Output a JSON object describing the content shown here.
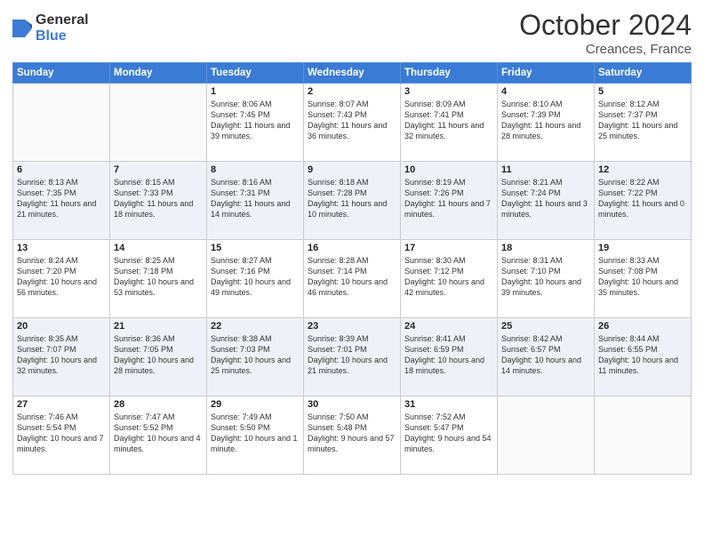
{
  "logo": {
    "general": "General",
    "blue": "Blue"
  },
  "header": {
    "month_year": "October 2024",
    "location": "Creances, France"
  },
  "days": [
    "Sunday",
    "Monday",
    "Tuesday",
    "Wednesday",
    "Thursday",
    "Friday",
    "Saturday"
  ],
  "weeks": [
    [
      {
        "num": "",
        "sunrise": "",
        "sunset": "",
        "daylight": ""
      },
      {
        "num": "",
        "sunrise": "",
        "sunset": "",
        "daylight": ""
      },
      {
        "num": "1",
        "sunrise": "Sunrise: 8:06 AM",
        "sunset": "Sunset: 7:45 PM",
        "daylight": "Daylight: 11 hours and 39 minutes."
      },
      {
        "num": "2",
        "sunrise": "Sunrise: 8:07 AM",
        "sunset": "Sunset: 7:43 PM",
        "daylight": "Daylight: 11 hours and 36 minutes."
      },
      {
        "num": "3",
        "sunrise": "Sunrise: 8:09 AM",
        "sunset": "Sunset: 7:41 PM",
        "daylight": "Daylight: 11 hours and 32 minutes."
      },
      {
        "num": "4",
        "sunrise": "Sunrise: 8:10 AM",
        "sunset": "Sunset: 7:39 PM",
        "daylight": "Daylight: 11 hours and 28 minutes."
      },
      {
        "num": "5",
        "sunrise": "Sunrise: 8:12 AM",
        "sunset": "Sunset: 7:37 PM",
        "daylight": "Daylight: 11 hours and 25 minutes."
      }
    ],
    [
      {
        "num": "6",
        "sunrise": "Sunrise: 8:13 AM",
        "sunset": "Sunset: 7:35 PM",
        "daylight": "Daylight: 11 hours and 21 minutes."
      },
      {
        "num": "7",
        "sunrise": "Sunrise: 8:15 AM",
        "sunset": "Sunset: 7:33 PM",
        "daylight": "Daylight: 11 hours and 18 minutes."
      },
      {
        "num": "8",
        "sunrise": "Sunrise: 8:16 AM",
        "sunset": "Sunset: 7:31 PM",
        "daylight": "Daylight: 11 hours and 14 minutes."
      },
      {
        "num": "9",
        "sunrise": "Sunrise: 8:18 AM",
        "sunset": "Sunset: 7:28 PM",
        "daylight": "Daylight: 11 hours and 10 minutes."
      },
      {
        "num": "10",
        "sunrise": "Sunrise: 8:19 AM",
        "sunset": "Sunset: 7:26 PM",
        "daylight": "Daylight: 11 hours and 7 minutes."
      },
      {
        "num": "11",
        "sunrise": "Sunrise: 8:21 AM",
        "sunset": "Sunset: 7:24 PM",
        "daylight": "Daylight: 11 hours and 3 minutes."
      },
      {
        "num": "12",
        "sunrise": "Sunrise: 8:22 AM",
        "sunset": "Sunset: 7:22 PM",
        "daylight": "Daylight: 11 hours and 0 minutes."
      }
    ],
    [
      {
        "num": "13",
        "sunrise": "Sunrise: 8:24 AM",
        "sunset": "Sunset: 7:20 PM",
        "daylight": "Daylight: 10 hours and 56 minutes."
      },
      {
        "num": "14",
        "sunrise": "Sunrise: 8:25 AM",
        "sunset": "Sunset: 7:18 PM",
        "daylight": "Daylight: 10 hours and 53 minutes."
      },
      {
        "num": "15",
        "sunrise": "Sunrise: 8:27 AM",
        "sunset": "Sunset: 7:16 PM",
        "daylight": "Daylight: 10 hours and 49 minutes."
      },
      {
        "num": "16",
        "sunrise": "Sunrise: 8:28 AM",
        "sunset": "Sunset: 7:14 PM",
        "daylight": "Daylight: 10 hours and 46 minutes."
      },
      {
        "num": "17",
        "sunrise": "Sunrise: 8:30 AM",
        "sunset": "Sunset: 7:12 PM",
        "daylight": "Daylight: 10 hours and 42 minutes."
      },
      {
        "num": "18",
        "sunrise": "Sunrise: 8:31 AM",
        "sunset": "Sunset: 7:10 PM",
        "daylight": "Daylight: 10 hours and 39 minutes."
      },
      {
        "num": "19",
        "sunrise": "Sunrise: 8:33 AM",
        "sunset": "Sunset: 7:08 PM",
        "daylight": "Daylight: 10 hours and 35 minutes."
      }
    ],
    [
      {
        "num": "20",
        "sunrise": "Sunrise: 8:35 AM",
        "sunset": "Sunset: 7:07 PM",
        "daylight": "Daylight: 10 hours and 32 minutes."
      },
      {
        "num": "21",
        "sunrise": "Sunrise: 8:36 AM",
        "sunset": "Sunset: 7:05 PM",
        "daylight": "Daylight: 10 hours and 28 minutes."
      },
      {
        "num": "22",
        "sunrise": "Sunrise: 8:38 AM",
        "sunset": "Sunset: 7:03 PM",
        "daylight": "Daylight: 10 hours and 25 minutes."
      },
      {
        "num": "23",
        "sunrise": "Sunrise: 8:39 AM",
        "sunset": "Sunset: 7:01 PM",
        "daylight": "Daylight: 10 hours and 21 minutes."
      },
      {
        "num": "24",
        "sunrise": "Sunrise: 8:41 AM",
        "sunset": "Sunset: 6:59 PM",
        "daylight": "Daylight: 10 hours and 18 minutes."
      },
      {
        "num": "25",
        "sunrise": "Sunrise: 8:42 AM",
        "sunset": "Sunset: 6:57 PM",
        "daylight": "Daylight: 10 hours and 14 minutes."
      },
      {
        "num": "26",
        "sunrise": "Sunrise: 8:44 AM",
        "sunset": "Sunset: 6:55 PM",
        "daylight": "Daylight: 10 hours and 11 minutes."
      }
    ],
    [
      {
        "num": "27",
        "sunrise": "Sunrise: 7:46 AM",
        "sunset": "Sunset: 5:54 PM",
        "daylight": "Daylight: 10 hours and 7 minutes."
      },
      {
        "num": "28",
        "sunrise": "Sunrise: 7:47 AM",
        "sunset": "Sunset: 5:52 PM",
        "daylight": "Daylight: 10 hours and 4 minutes."
      },
      {
        "num": "29",
        "sunrise": "Sunrise: 7:49 AM",
        "sunset": "Sunset: 5:50 PM",
        "daylight": "Daylight: 10 hours and 1 minute."
      },
      {
        "num": "30",
        "sunrise": "Sunrise: 7:50 AM",
        "sunset": "Sunset: 5:48 PM",
        "daylight": "Daylight: 9 hours and 57 minutes."
      },
      {
        "num": "31",
        "sunrise": "Sunrise: 7:52 AM",
        "sunset": "Sunset: 5:47 PM",
        "daylight": "Daylight: 9 hours and 54 minutes."
      },
      {
        "num": "",
        "sunrise": "",
        "sunset": "",
        "daylight": ""
      },
      {
        "num": "",
        "sunrise": "",
        "sunset": "",
        "daylight": ""
      }
    ]
  ]
}
